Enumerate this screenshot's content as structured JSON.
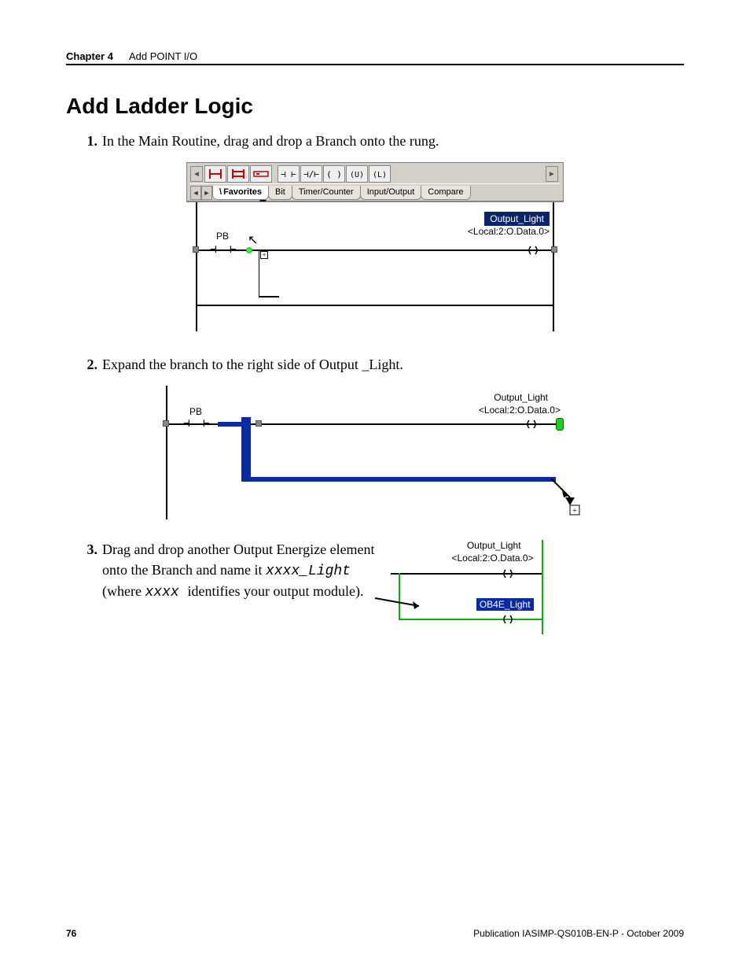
{
  "header": {
    "chapter": "Chapter 4",
    "title": "Add POINT I/O"
  },
  "heading": "Add Ladder Logic",
  "steps": {
    "s1": {
      "num": "1.",
      "text": "In the Main Routine, drag and drop a Branch onto the rung."
    },
    "s2": {
      "num": "2.",
      "text": "Expand the branch to the right side of Output _Light."
    },
    "s3": {
      "num": "3.",
      "line1": "Drag and drop another Output Energize element",
      "line2a": "onto the Branch and name it ",
      "line2code": "xxxx_Light",
      "line3a": "(where ",
      "line3code": "xxxx ",
      "line3b": " identifies your output module)."
    }
  },
  "fig1": {
    "tabs": [
      "Favorites",
      "Bit",
      "Timer/Counter",
      "Input/Output",
      "Compare"
    ],
    "pb": "PB",
    "out_tag": "Output_Light",
    "out_addr": "<Local:2:O.Data.0>"
  },
  "fig2": {
    "pb": "PB",
    "out_tag": "Output_Light",
    "out_addr": "<Local:2:O.Data.0>"
  },
  "fig3": {
    "out_tag": "Output_Light",
    "out_addr": "<Local:2:O.Data.0>",
    "new_tag": "OB4E_Light"
  },
  "footer": {
    "page": "76",
    "pub": "Publication IASIMP-QS010B-EN-P - October 2009"
  }
}
